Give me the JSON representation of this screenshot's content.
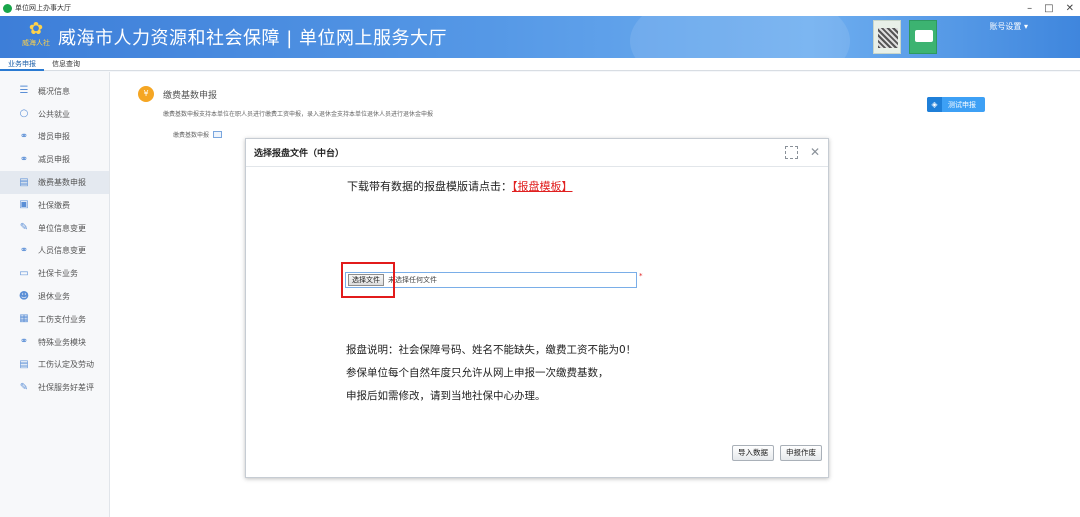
{
  "window": {
    "title": "单位网上办事大厅",
    "minimize": "–",
    "maximize": "□",
    "close": "✕"
  },
  "banner": {
    "logo_text": "威海人社",
    "site_title": "威海市人力资源和社会保障 | 单位网上服务大厅",
    "account_label": "账号设置 ▾"
  },
  "tabs": [
    {
      "label": "业务申报",
      "active": true
    },
    {
      "label": "信息查询",
      "active": false
    }
  ],
  "sidebar": {
    "items": [
      {
        "label": "概况信息",
        "icon": "layers-icon"
      },
      {
        "label": "公共就业",
        "icon": "globe-icon"
      },
      {
        "label": "增员申报",
        "icon": "user-add-icon"
      },
      {
        "label": "减员申报",
        "icon": "user-remove-icon"
      },
      {
        "label": "缴费基数申报",
        "icon": "document-icon",
        "active": true
      },
      {
        "label": "社保缴费",
        "icon": "card-icon"
      },
      {
        "label": "单位信息变更",
        "icon": "edit-icon"
      },
      {
        "label": "人员信息变更",
        "icon": "people-icon"
      },
      {
        "label": "社保卡业务",
        "icon": "id-card-icon"
      },
      {
        "label": "退休业务",
        "icon": "retire-icon"
      },
      {
        "label": "工伤支付业务",
        "icon": "calendar-icon"
      },
      {
        "label": "特殊业务模块",
        "icon": "people-special-icon"
      },
      {
        "label": "工伤认定及劳动",
        "icon": "document-icon"
      },
      {
        "label": "社保服务好差评",
        "icon": "edit-icon"
      }
    ]
  },
  "main": {
    "heading": "缴费基数申报",
    "description": "缴费基数申报支持本单位在职人员进行缴费工资申报，录入退休金支持本单位退休人员进行退休金申报",
    "base_label": "缴费基数申报",
    "right_button": "测试申报"
  },
  "dialog": {
    "title": "选择报盘文件（中台）",
    "download_prefix": "下载带有数据的报盘模版请点击：",
    "template_link": "【报盘模板】",
    "choose_file": "选择文件",
    "no_file": "未选择任何文件",
    "required_mark": "*",
    "notes": [
      "报盘说明：社会保障号码、姓名不能缺失，缴费工资不能为0！",
      "参保单位每个自然年度只允许从网上申报一次缴费基数，",
      "申报后如需修改，请到当地社保中心办理。"
    ],
    "import_button": "导入数据",
    "void_button": "申报作废"
  },
  "colors": {
    "brand_blue": "#3d7ed8",
    "highlight_red": "#e21b1b",
    "link_red": "#e02020"
  }
}
